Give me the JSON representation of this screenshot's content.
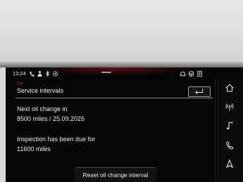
{
  "status": {
    "time": "13:24",
    "left_icons": [
      "phone-bluetooth-icon",
      "person-icon",
      "bluetooth-icon",
      "settings-icon"
    ],
    "right_icons": [
      "car-icon",
      "steering-icon",
      "document-icon"
    ]
  },
  "header": {
    "breadcrumb": "Car",
    "title": "Service intervals"
  },
  "oil": {
    "label": "Next oil change in",
    "value": "8500 miles / 25.09.2026"
  },
  "inspection": {
    "label": "Inspection has been due for",
    "value": "11600 miles"
  },
  "actions": {
    "reset_label": "Reset oil change interval"
  },
  "sidebar": {
    "items": [
      "home-icon",
      "radio-icon",
      "music-icon",
      "phone-icon",
      "navigation-icon"
    ]
  },
  "colors": {
    "accent": "#d03b3b",
    "background": "#050505",
    "text": "#ececec"
  }
}
